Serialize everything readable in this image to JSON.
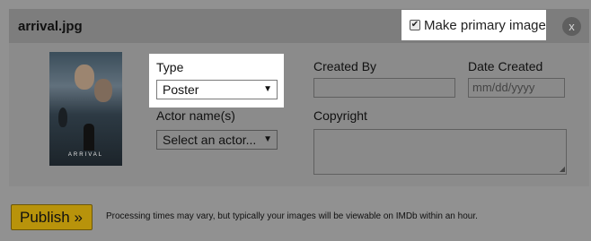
{
  "image": {
    "filename": "arrival.jpg",
    "poster_title": "ARRIVAL"
  },
  "primary": {
    "label": "Make primary image",
    "checked": true,
    "check_glyph": "✔"
  },
  "close": {
    "glyph": "x"
  },
  "form": {
    "type_label": "Type",
    "type_value": "Poster",
    "actor_label": "Actor name(s)",
    "actor_value": "Select an actor...",
    "created_by_label": "Created By",
    "created_by_value": "",
    "date_created_label": "Date Created",
    "date_placeholder": "mm/dd/yyyy",
    "copyright_label": "Copyright",
    "copyright_value": "",
    "dropdown_glyph": "▼"
  },
  "footer": {
    "publish_label": "Publish »",
    "note": "Processing times may vary, but typically your images will be viewable on IMDb within an hour."
  },
  "colors": {
    "overlay": "#919191",
    "publish": "#b8930b",
    "highlight": "#ffffff"
  }
}
